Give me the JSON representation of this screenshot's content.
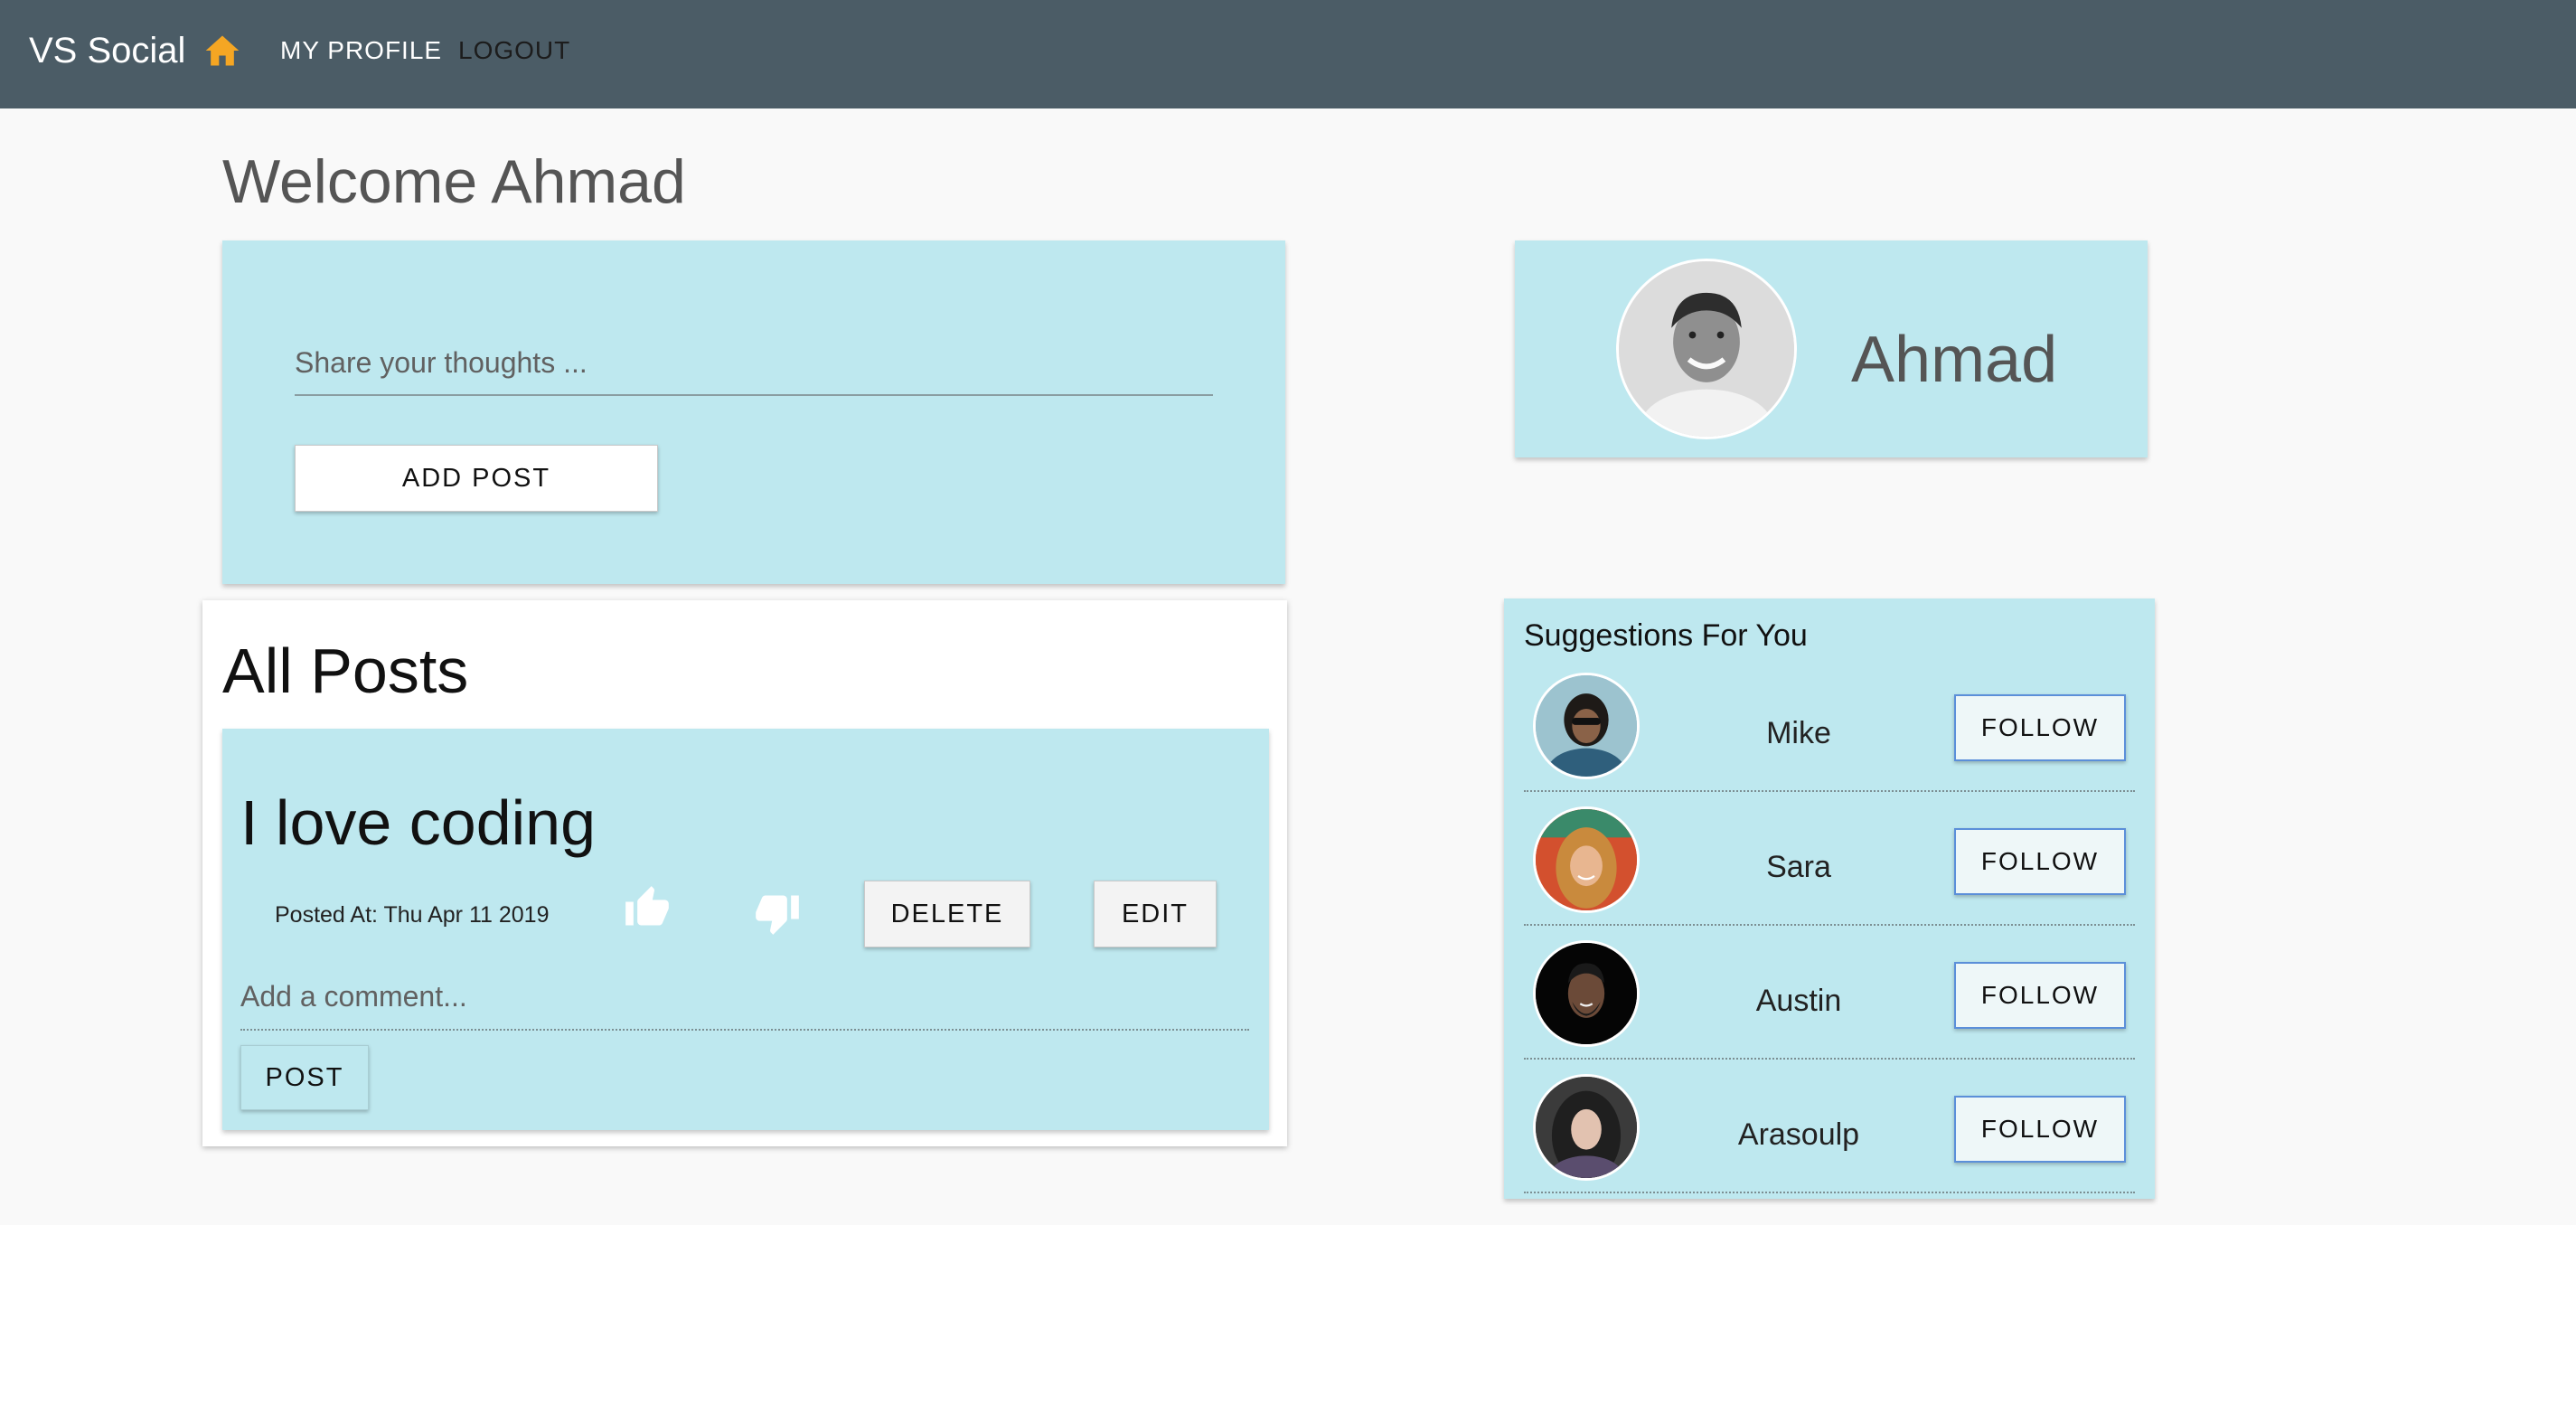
{
  "navbar": {
    "brand": "VS Social",
    "icon": "home-icon",
    "links": [
      "MY PROFILE",
      "LOGOUT"
    ]
  },
  "welcome": "Welcome Ahmad",
  "composer": {
    "placeholder": "Share your thoughts ...",
    "add_post_label": "ADD POST"
  },
  "profile": {
    "name": "Ahmad",
    "avatar": "avatar-icon"
  },
  "posts": {
    "heading": "All Posts",
    "items": [
      {
        "title": "I love coding",
        "posted_at": "Posted At: Thu Apr 11 2019",
        "like_icon": "thumb-up-icon",
        "dislike_icon": "thumb-down-icon",
        "delete_label": "DELETE",
        "edit_label": "EDIT",
        "comment_placeholder": "Add a comment...",
        "post_label": "POST"
      }
    ]
  },
  "suggestions": {
    "title": "Suggestions For You",
    "follow_label": "FOLLOW",
    "users": [
      {
        "name": "Mike"
      },
      {
        "name": "Sara"
      },
      {
        "name": "Austin"
      },
      {
        "name": "Arasoulp"
      }
    ]
  },
  "colors": {
    "navbar": "#4b5c66",
    "card": "#bee8ef",
    "home_icon": "#f5a623",
    "follow_border": "#5b8fd9"
  }
}
